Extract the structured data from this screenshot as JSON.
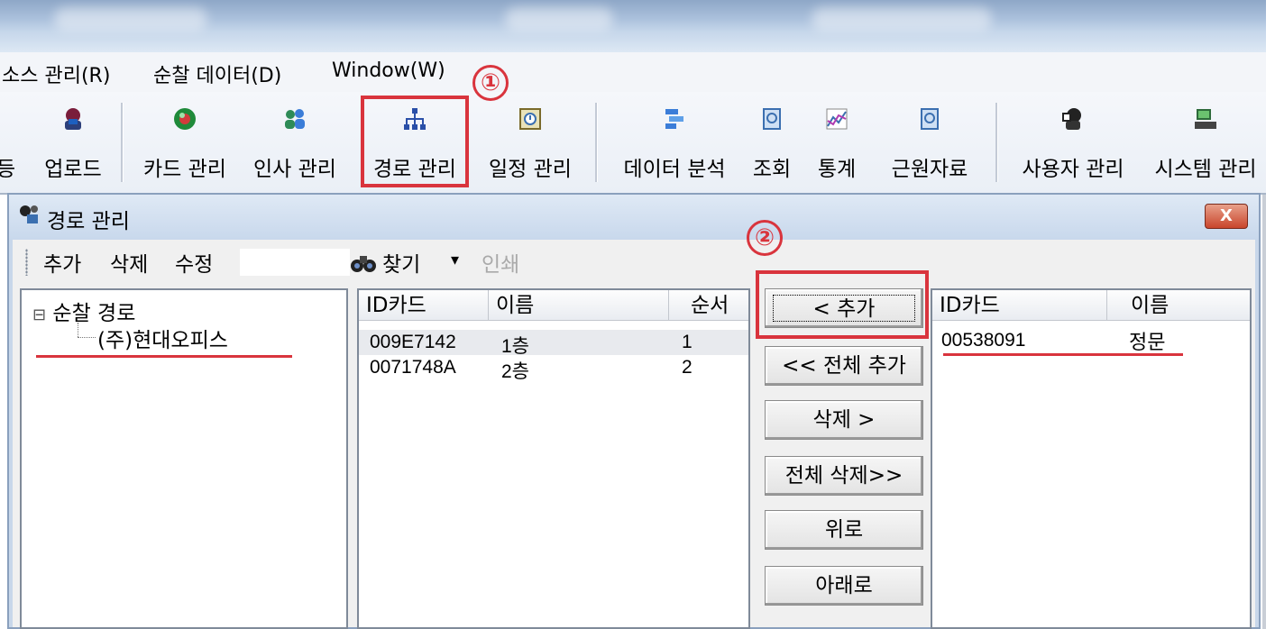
{
  "menu": {
    "items": [
      "소스 관리(R)",
      "순찰 데이터(D)",
      "Window(W)"
    ]
  },
  "toolbar": {
    "cut_label": "등",
    "buttons": [
      {
        "label": "업로드",
        "icon": "upload-person-icon"
      },
      {
        "label": "카드 관리",
        "icon": "card-globe-icon"
      },
      {
        "label": "인사 관리",
        "icon": "people-icon"
      },
      {
        "label": "경로 관리",
        "icon": "route-tree-icon"
      },
      {
        "label": "일정 관리",
        "icon": "schedule-icon"
      },
      {
        "label": "데이터 분석",
        "icon": "data-analysis-icon"
      },
      {
        "label": "조회",
        "icon": "lookup-icon"
      },
      {
        "label": "통계",
        "icon": "statistics-chart-icon"
      },
      {
        "label": "근원자료",
        "icon": "source-data-icon"
      },
      {
        "label": "사용자 관리",
        "icon": "user-admin-icon"
      },
      {
        "label": "시스템 관리",
        "icon": "system-computer-icon"
      }
    ]
  },
  "callouts": {
    "one": "①",
    "two": "②"
  },
  "window": {
    "title": "경로 관리",
    "close": "X",
    "toolbar": {
      "add": "추가",
      "delete": "삭제",
      "edit": "수정",
      "find": "찾기",
      "dropdown": "▾",
      "print": "인쇄"
    }
  },
  "tree": {
    "root": "순찰 경로",
    "expander": "⊟",
    "child": "(주)현대오피스"
  },
  "left_list": {
    "columns": [
      "ID카드",
      "이름",
      "순서"
    ],
    "rows": [
      {
        "id": "009E7142",
        "name": "1층",
        "order": "1"
      },
      {
        "id": "0071748A",
        "name": "2층",
        "order": "2"
      }
    ]
  },
  "actions": {
    "add": "< 추가",
    "add_all": "<< 전체 추가",
    "delete": "삭제 >",
    "delete_all": "전체 삭제>>",
    "up": "위로",
    "down": "아래로"
  },
  "right_list": {
    "columns": [
      "ID카드",
      "이름"
    ],
    "rows": [
      {
        "id": "00538091",
        "name": "정문"
      }
    ]
  },
  "colors": {
    "highlight": "#d9343d",
    "window_bg": "#f0f0f0",
    "title_blue": "#aac0dc"
  }
}
